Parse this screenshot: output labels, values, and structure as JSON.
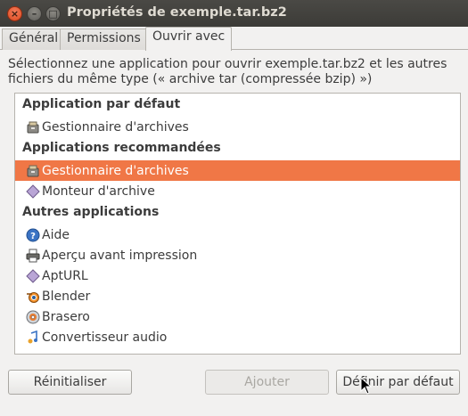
{
  "window": {
    "title": "Propriétés de exemple.tar.bz2",
    "controls": {
      "close": "×",
      "minimize": "–",
      "maximize": "□"
    }
  },
  "tabs": [
    {
      "label": "Général",
      "active": false
    },
    {
      "label": "Permissions",
      "active": false
    },
    {
      "label": "Ouvrir avec",
      "active": true
    }
  ],
  "description": "Sélectionnez une application pour ouvrir exemple.tar.bz2 et les autres fichiers du même type (« archive tar (compressée bzip) »)",
  "list": {
    "default_header": "Application par défaut",
    "default_app": {
      "label": "Gestionnaire d'archives",
      "icon": "archive-manager-icon"
    },
    "recommended_header": "Applications recommandées",
    "recommended": [
      {
        "label": "Gestionnaire d'archives",
        "icon": "archive-manager-icon",
        "selected": true
      },
      {
        "label": "Monteur d'archive",
        "icon": "archive-mounter-icon",
        "selected": false
      }
    ],
    "other_header": "Autres applications",
    "other": [
      {
        "label": "Aide",
        "icon": "help-icon"
      },
      {
        "label": "Aperçu avant impression",
        "icon": "print-preview-icon"
      },
      {
        "label": "AptURL",
        "icon": "apturl-icon"
      },
      {
        "label": "Blender",
        "icon": "blender-icon"
      },
      {
        "label": "Brasero",
        "icon": "brasero-icon"
      },
      {
        "label": "Convertisseur audio",
        "icon": "audio-converter-icon"
      }
    ]
  },
  "buttons": {
    "reset": "Réinitialiser",
    "add": "Ajouter",
    "set_default": "Définir par défaut"
  },
  "colors": {
    "titlebar": "#3c3b37",
    "selection": "#f07746",
    "window_bg": "#f2f1f0"
  }
}
